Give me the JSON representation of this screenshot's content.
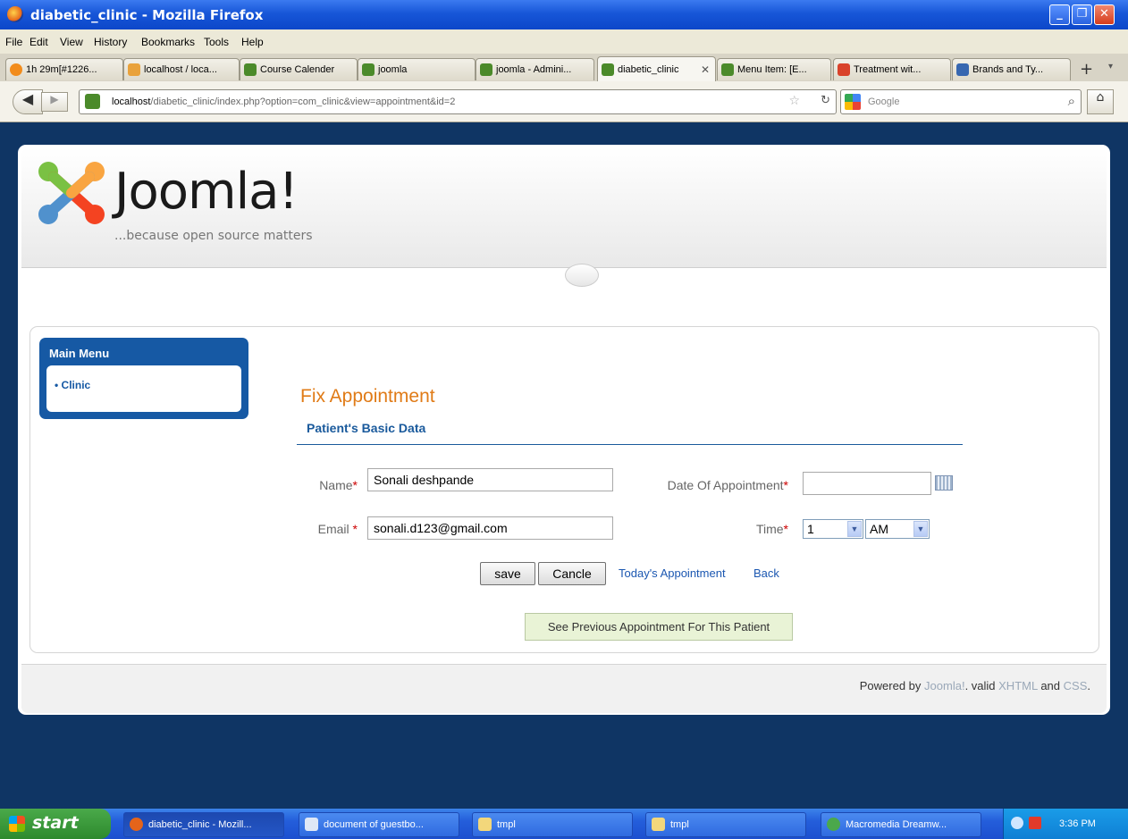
{
  "window": {
    "title": "diabetic_clinic - Mozilla Firefox"
  },
  "menubar": [
    "File",
    "Edit",
    "View",
    "History",
    "Bookmarks",
    "Tools",
    "Help"
  ],
  "tabs": [
    {
      "label": "1h 29m[#1226..."
    },
    {
      "label": "localhost / loca..."
    },
    {
      "label": "Course Calender"
    },
    {
      "label": "joomla"
    },
    {
      "label": "joomla - Admini..."
    },
    {
      "label": "diabetic_clinic"
    },
    {
      "label": "Menu Item: [E..."
    },
    {
      "label": "Treatment wit..."
    },
    {
      "label": "Brands and Ty..."
    }
  ],
  "tab_new": "+",
  "url": {
    "host": "localhost",
    "path": "/diabetic_clinic/index.php?option=com_clinic&view=appointment&id=2"
  },
  "search": {
    "placeholder": "Google"
  },
  "site": {
    "logo_text": "Joomla!",
    "tagline": "...because open source matters"
  },
  "main_menu": {
    "title": "Main Menu",
    "items": [
      "Clinic"
    ]
  },
  "form": {
    "title": "Fix Appointment",
    "subtitle": "Patient's Basic Data",
    "name_label": "Name",
    "name_value": "Sonali deshpande",
    "email_label": "Email ",
    "email_value": "sonali.d123@gmail.com",
    "date_label": "Date Of Appointment",
    "date_value": "",
    "time_label": "Time",
    "hour_value": "1",
    "ampm_value": "AM",
    "required_mark": "*",
    "save_label": "save",
    "cancel_label": "Cancle",
    "todays_link": "Today's Appointment",
    "back_link": "Back",
    "previous_label": "See Previous Appointment For This Patient"
  },
  "footer": {
    "powered": "Powered by ",
    "joomla": "Joomla!",
    "valid": ". valid ",
    "xhtml": "XHTML",
    "and": " and ",
    "css": "CSS",
    "end": "."
  },
  "taskbar": {
    "start": "start",
    "tasks": [
      "diabetic_clinic - Mozill...",
      "document of guestbo...",
      "tmpl",
      "tmpl",
      "Macromedia Dreamw..."
    ],
    "clock": "3:36 PM"
  },
  "colors": {
    "accent_blue": "#1659a4",
    "title_orange": "#e07b17",
    "page_bg": "#0f3564"
  }
}
